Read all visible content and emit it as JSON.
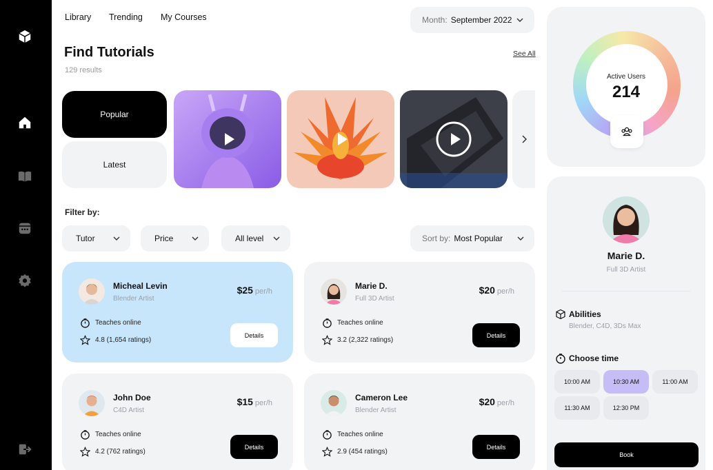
{
  "nav": {
    "library": "Library",
    "trending": "Trending",
    "my_courses": "My Courses"
  },
  "month": {
    "label": "Month:",
    "value": "September 2022"
  },
  "page": {
    "title": "Find Tutorials",
    "results": "129 results",
    "see_all": "See All"
  },
  "categories": {
    "popular": "Popular",
    "latest": "Latest"
  },
  "filters": {
    "label": "Filter by:",
    "tutor": "Tutor",
    "price": "Price",
    "level": "All level",
    "sort_label": "Sort by:",
    "sort_value": "Most Popular"
  },
  "tutors": [
    {
      "name": "Micheal Levin",
      "role": "Blender Artist",
      "price": "$25",
      "per": "per/h",
      "teaches": "Teaches online",
      "rating": "4.8 (1,654 ratings)",
      "details": "Details"
    },
    {
      "name": "Marie D.",
      "role": "Full 3D Artist",
      "price": "$20",
      "per": "per/h",
      "teaches": "Teaches online",
      "rating": "3.2 (2,322 ratings)",
      "details": "Details"
    },
    {
      "name": "John Doe",
      "role": "C4D Artist",
      "price": "$15",
      "per": "per/h",
      "teaches": "Teaches online",
      "rating": "4.2 (762 ratings)",
      "details": "Details"
    },
    {
      "name": "Cameron Lee",
      "role": "Blender Artist",
      "price": "$20",
      "per": "per/h",
      "teaches": "Teaches online",
      "rating": "2.9 (454 ratings)",
      "details": "Details"
    }
  ],
  "active_users": {
    "label": "Active Users",
    "value": "214"
  },
  "profile": {
    "name": "Marie D.",
    "role": "Full 3D Artist",
    "abilities_title": "Abilities",
    "abilities": "Blender, C4D, 3Ds Max",
    "choose_time": "Choose time",
    "slots": [
      "10:00 AM",
      "10:30 AM",
      "11:00 AM",
      "11:30 AM",
      "12:30 PM"
    ],
    "book": "Book"
  },
  "colors": {
    "accent_blue": "#c8e6fb",
    "selected_slot": "#c6bdf7",
    "panel": "#f2f3f5"
  }
}
